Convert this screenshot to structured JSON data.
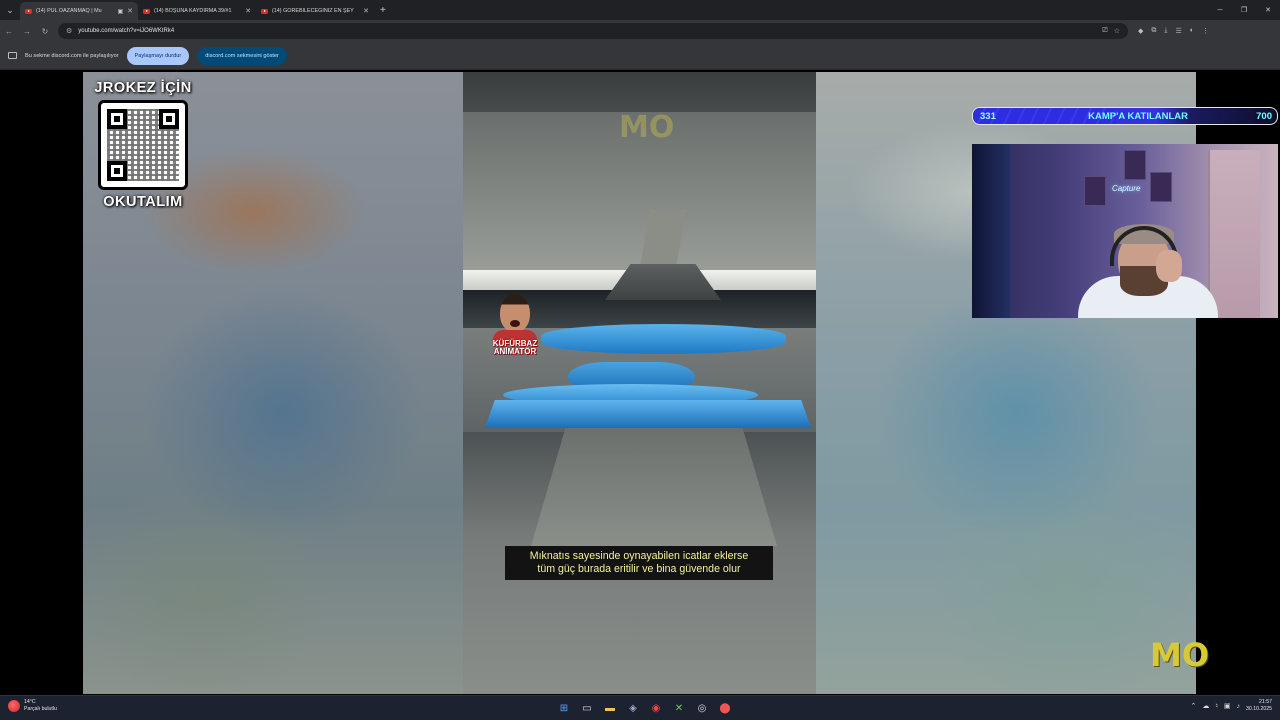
{
  "browser": {
    "tabs": [
      {
        "title": "(14) PUL OAZANMAQ | Mu",
        "active": true,
        "audio_icon": "audio-playing-icon"
      },
      {
        "title": "(14) BOŞUNA KAYDIRMA 39/#1",
        "active": false
      },
      {
        "title": "(14) GÖREBİLECEĞİNİZ EN ŞEY",
        "active": false
      }
    ],
    "url": "youtube.com/watch?v=iJO6WKtRk4"
  },
  "sharebar": {
    "message": "Bu sekme discord.com ile paylaşılıyor",
    "stop_label": "Paylaşmayı durdur",
    "show_label": "discord.com sekmesini göster"
  },
  "overlay": {
    "qr_title": "JROKEZ İÇİN",
    "qr_subtitle": "OKUTALIM",
    "camp_current": "331",
    "camp_label": "KAMP'A KATILANLAR",
    "camp_max": "700",
    "camp_progress_fraction": 0.47,
    "webcam_sign": "Capture"
  },
  "video": {
    "caption_line1": "Mıknatıs sayesinde oynayabilen icatlar eklerse",
    "caption_line2": "tüm güç burada eritilir ve bina güvende olur",
    "animator_label_1": "KÜFÜRBAZ",
    "animator_label_2": "ANİMATÖR",
    "watermark": "MO"
  },
  "taskbar": {
    "weather_temp": "14°C",
    "weather_desc": "Parçalı bulutlu",
    "time": "21:57",
    "date": "30.10.2025"
  },
  "colors": {
    "accent_blue": "#a8c7fa",
    "camp_bar": "#2d2bd8",
    "caption_text": "#f6f29a"
  }
}
